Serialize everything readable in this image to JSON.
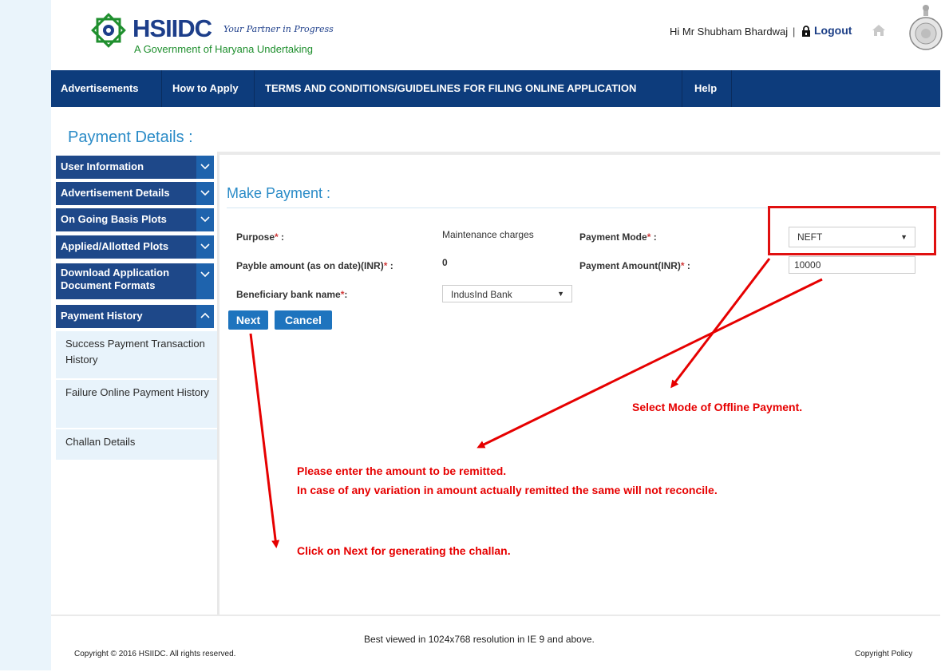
{
  "header": {
    "org_name": "HSIIDC",
    "tagline": "Your Partner in Progress",
    "subtitle": "A Government of Haryana Undertaking",
    "greeting": "Hi Mr Shubham Bhardwaj",
    "separator": "|",
    "logout_label": "Logout"
  },
  "nav": {
    "items": [
      {
        "label": "Advertisements"
      },
      {
        "label": "How to Apply"
      },
      {
        "label": "TERMS AND CONDITIONS/GUIDELINES FOR FILING ONLINE APPLICATION"
      },
      {
        "label": "Help"
      }
    ]
  },
  "page": {
    "title": "Payment Details :"
  },
  "sidebar": {
    "items": [
      {
        "label": "User Information",
        "expanded": false
      },
      {
        "label": "Advertisement Details",
        "expanded": false
      },
      {
        "label": "On Going Basis Plots",
        "expanded": false
      },
      {
        "label": "Applied/Allotted Plots",
        "expanded": false
      },
      {
        "label": "Download Application Document Formats",
        "line1": "Download Application",
        "line2": "Document Formats",
        "expanded": false
      },
      {
        "label": "Payment History",
        "expanded": true
      }
    ],
    "sub_items": [
      {
        "label": "Success Payment Transaction History"
      },
      {
        "label": "Failure Online Payment History"
      },
      {
        "label": "Challan Details"
      }
    ]
  },
  "form": {
    "section_title": "Make Payment :",
    "required_mark": "*",
    "purpose_label": "Purpose",
    "purpose_value": "Maintenance charges",
    "payable_label": "Payble amount (as on date)(INR)",
    "payable_value": "0",
    "bank_label": "Beneficiary bank name",
    "bank_value": "IndusInd Bank",
    "mode_label": "Payment Mode",
    "mode_value": "NEFT",
    "amount_label": "Payment Amount(INR)",
    "amount_value": "10000",
    "label_suffix": " :",
    "bank_suffix": ":",
    "next_label": "Next",
    "cancel_label": "Cancel"
  },
  "annotations": {
    "mode_note": "Select Mode of Offline Payment.",
    "amount_note_1": "Please enter the amount to be remitted.",
    "amount_note_2": "In case of any variation in amount actually remitted the same will not reconcile.",
    "next_note": "Click on Next for generating the challan.",
    "color": "#e60000"
  },
  "footer": {
    "best_viewed": "Best viewed in 1024x768 resolution in IE 9 and above.",
    "copyright": "Copyright © 2016 HSIIDC. All rights reserved.",
    "policy_label": "Copyright Policy"
  },
  "colors": {
    "nav_bg": "#0d3c7c",
    "sidebar_item_bg": "#1e4889",
    "accent_blue": "#2a8bc7",
    "button_bg": "#1e74be"
  }
}
